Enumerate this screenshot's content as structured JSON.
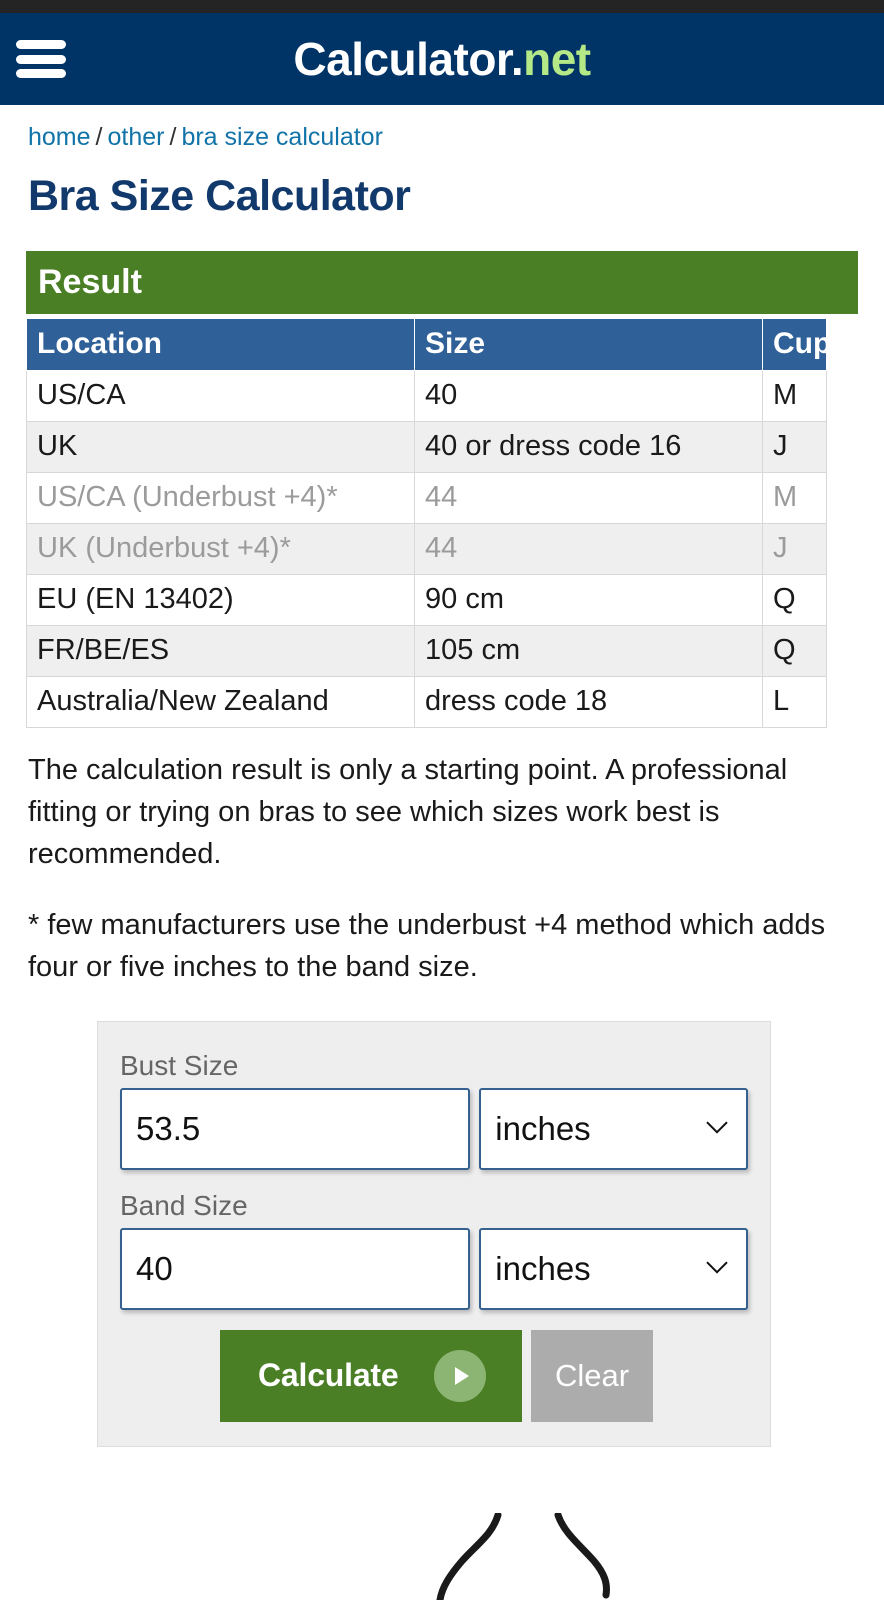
{
  "header": {
    "menu_icon": "hamburger-icon",
    "brand_main": "Calculator",
    "brand_dot": ".",
    "brand_net": "net",
    "navy_color": "#003366",
    "accent_green": "#b5e887"
  },
  "breadcrumb": {
    "items": [
      "home",
      "other",
      "bra size calculator"
    ],
    "separator": "/",
    "link_color": "#1273a8"
  },
  "page": {
    "title": "Bra Size Calculator",
    "title_color": "#11396b"
  },
  "result": {
    "heading": "Result",
    "heading_bg": "#4b7f26",
    "table_header_bg": "#2f6098",
    "columns": [
      "Location",
      "Size",
      "Cup"
    ],
    "rows": [
      {
        "location": "US/CA",
        "size": "40",
        "cup": "M",
        "muted": false
      },
      {
        "location": "UK",
        "size": "40 or dress code 16",
        "cup": "J",
        "muted": false
      },
      {
        "location": "US/CA (Underbust +4)*",
        "size": "44",
        "cup": "M",
        "muted": true
      },
      {
        "location": "UK (Underbust +4)*",
        "size": "44",
        "cup": "J",
        "muted": true
      },
      {
        "location": "EU (EN 13402)",
        "size": "90 cm",
        "cup": "Q",
        "muted": false
      },
      {
        "location": "FR/BE/ES",
        "size": "105 cm",
        "cup": "Q",
        "muted": false
      },
      {
        "location": "Australia/New Zealand",
        "size": "dress code 18",
        "cup": "L",
        "muted": false
      }
    ]
  },
  "notes": {
    "disclaimer": "The calculation result is only a starting point. A professional fitting or trying on bras to see which sizes work best is recommended.",
    "footnote": "* few manufacturers use the underbust +4 method which adds four or five inches to the band size."
  },
  "form": {
    "bust": {
      "label": "Bust Size",
      "value": "53.5",
      "placeholder": "",
      "unit": "inches"
    },
    "band": {
      "label": "Band Size",
      "value": "40",
      "placeholder": "",
      "unit": "inches"
    },
    "calculate_label": "Calculate",
    "calculate_icon": "play-icon",
    "clear_label": "Clear",
    "calculate_color": "#4b7f26",
    "clear_color": "#acacac"
  }
}
